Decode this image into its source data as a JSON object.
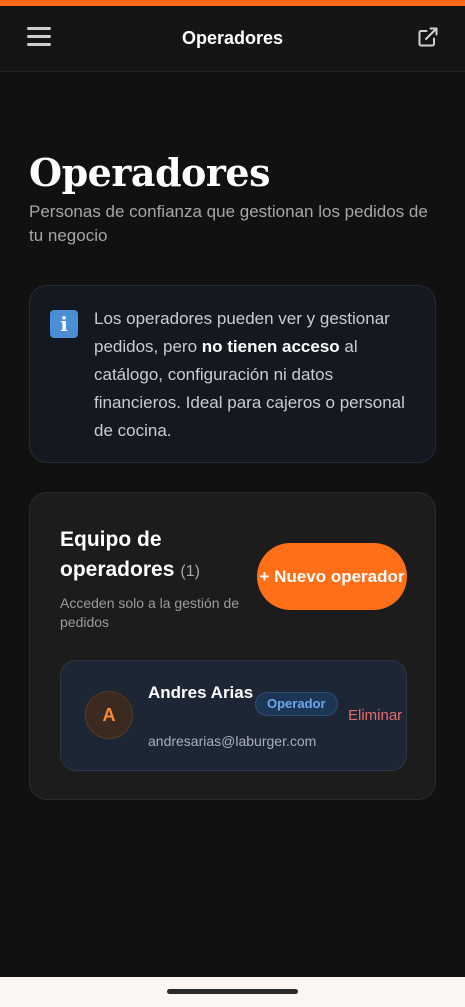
{
  "app_bar": {
    "title": "Operadores",
    "menu_icon": "hamburger-menu-icon",
    "open_icon": "external-link-icon"
  },
  "page": {
    "title": "Operadores",
    "subtitle": "Personas de confianza que gestionan los pedidos de tu negocio"
  },
  "info": {
    "icon": "info-icon",
    "text_before": "Los operadores pueden ver y gestionar pedidos, pero ",
    "text_bold": "no tienen acceso",
    "text_after": " al catálogo, configuración ni datos financieros. Ideal para cajeros o personal de cocina."
  },
  "team": {
    "title": "Equipo de operadores",
    "count": "(1)",
    "description": "Acceden solo a la gestión de pedidos",
    "new_button": "+ Nuevo operador",
    "operators": [
      {
        "initial": "A",
        "name": "Andres Arias",
        "email": "andresarias@laburger.com",
        "role": "Operador",
        "remove_label": "Eliminar"
      }
    ]
  },
  "colors": {
    "accent": "#ff6f17",
    "background": "#111111",
    "role_badge": "#6ea8ec",
    "danger": "#e56b6b"
  }
}
